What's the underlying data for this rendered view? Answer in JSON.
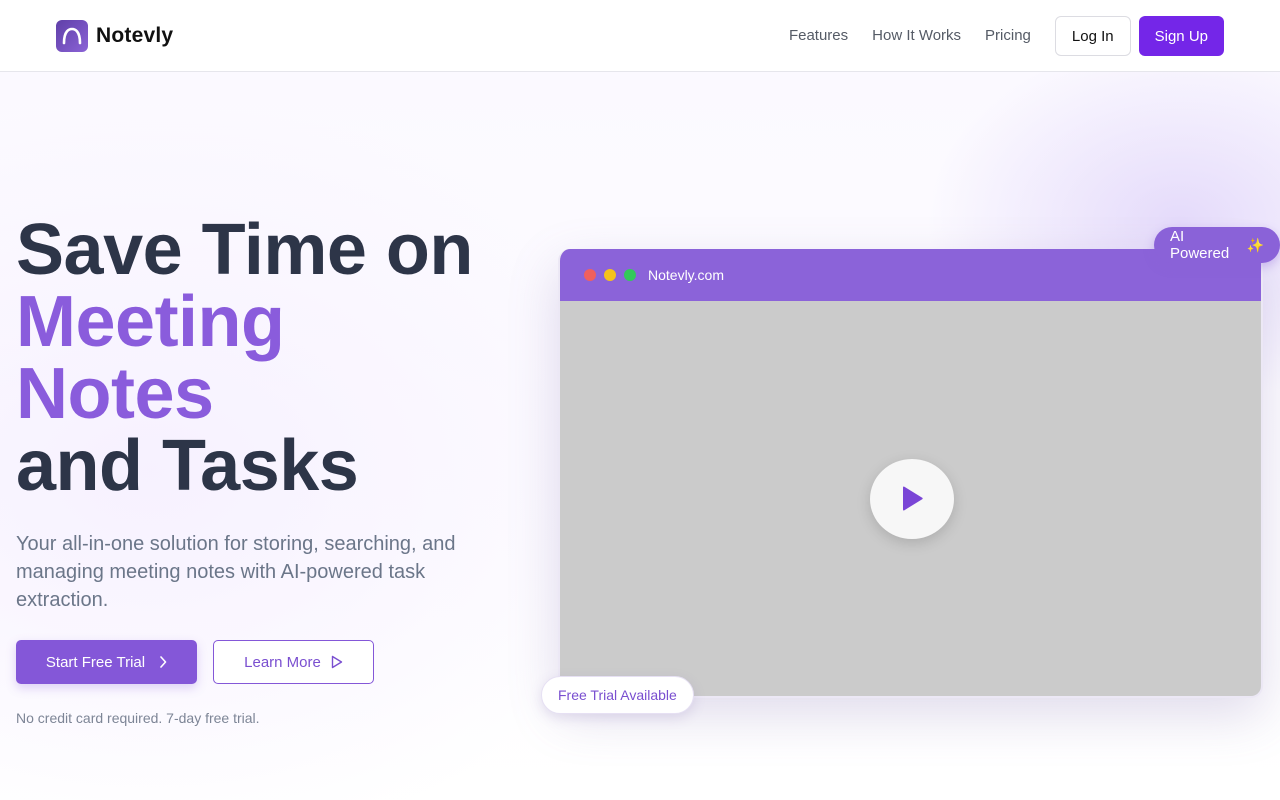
{
  "brand": {
    "name": "Notevly",
    "logo_icon": "notevly-logo-icon",
    "accent": "#7426e8"
  },
  "nav": {
    "links": [
      "Features",
      "How It Works",
      "Pricing"
    ],
    "login_label": "Log In",
    "signup_label": "Sign Up"
  },
  "hero": {
    "headline": {
      "line1": "Save Time on",
      "line2": "Meeting",
      "line3": "Notes",
      "line4": "and Tasks"
    },
    "subtitle": "Your all-in-one solution for storing, searching, and managing meeting notes with AI-powered task extraction.",
    "primary_cta": "Start Free Trial",
    "secondary_cta": "Learn More",
    "footnote": "No credit card required. 7-day free trial."
  },
  "preview": {
    "url": "Notevly.com",
    "ai_badge": "AI Powered",
    "ai_badge_icon": "sparkles-icon",
    "trial_badge": "Free Trial Available",
    "play_icon": "play-icon"
  },
  "colors": {
    "primary": "#8457d8",
    "headline_dark": "#2d3548",
    "headline_accent": "#8a5cdc",
    "card_bar": "#8b63d9"
  }
}
